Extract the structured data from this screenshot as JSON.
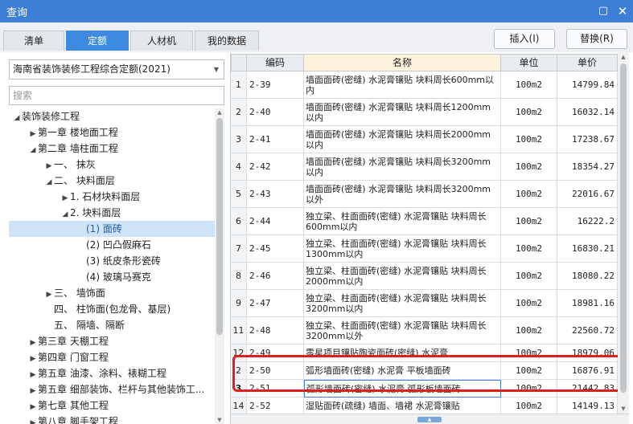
{
  "window": {
    "title": "查询"
  },
  "tabs": [
    {
      "label": "清单",
      "active": false
    },
    {
      "label": "定额",
      "active": true
    },
    {
      "label": "人材机",
      "active": false
    },
    {
      "label": "我的数据",
      "active": false
    }
  ],
  "actions": {
    "insert_label": "插入(I)",
    "replace_label": "替换(R)"
  },
  "left": {
    "library_select": "海南省装饰装修工程综合定额(2021)",
    "search_placeholder": "搜索",
    "tree": [
      {
        "label": "装饰装修工程",
        "indent": 0,
        "arrow": "down",
        "selected": false
      },
      {
        "label": "第一章 楼地面工程",
        "indent": 1,
        "arrow": "right",
        "selected": false
      },
      {
        "label": "第二章 墙柱面工程",
        "indent": 1,
        "arrow": "down",
        "selected": false
      },
      {
        "label": "一、 抹灰",
        "indent": 2,
        "arrow": "right",
        "selected": false
      },
      {
        "label": "二、 块料面层",
        "indent": 2,
        "arrow": "down",
        "selected": false
      },
      {
        "label": "1. 石材块料面层",
        "indent": 3,
        "arrow": "right",
        "selected": false
      },
      {
        "label": "2. 块料面层",
        "indent": 3,
        "arrow": "down",
        "selected": false
      },
      {
        "label": "(1) 面砖",
        "indent": 4,
        "arrow": "",
        "selected": true
      },
      {
        "label": "(2) 凹凸假麻石",
        "indent": 4,
        "arrow": "",
        "selected": false
      },
      {
        "label": "(3) 纸皮条形瓷砖",
        "indent": 4,
        "arrow": "",
        "selected": false
      },
      {
        "label": "(4) 玻璃马赛克",
        "indent": 4,
        "arrow": "",
        "selected": false
      },
      {
        "label": "三、 墙饰面",
        "indent": 2,
        "arrow": "right",
        "selected": false
      },
      {
        "label": "四、 柱饰面(包龙骨、基层)",
        "indent": 2,
        "arrow": "",
        "selected": false
      },
      {
        "label": "五、 隔墙、隔断",
        "indent": 2,
        "arrow": "",
        "selected": false
      },
      {
        "label": "第三章 天棚工程",
        "indent": 1,
        "arrow": "right",
        "selected": false
      },
      {
        "label": "第四章 门窗工程",
        "indent": 1,
        "arrow": "right",
        "selected": false
      },
      {
        "label": "第五章 油漆、涂料、裱糊工程",
        "indent": 1,
        "arrow": "right",
        "selected": false
      },
      {
        "label": "第五章 细部装饰、栏杆与其他装饰工...",
        "indent": 1,
        "arrow": "right",
        "selected": false
      },
      {
        "label": "第七章 其他工程",
        "indent": 1,
        "arrow": "right",
        "selected": false
      },
      {
        "label": "第八章 脚手架工程",
        "indent": 1,
        "arrow": "right",
        "selected": false
      }
    ]
  },
  "table": {
    "headers": {
      "code": "编码",
      "name": "名称",
      "unit": "单位",
      "price": "单价"
    },
    "rows": [
      {
        "idx": "1",
        "code": "2-39",
        "name": "墙面面砖(密缝) 水泥膏镶贴 块料周长600mm以内",
        "unit": "100m2",
        "price": "14799.84",
        "current": false,
        "h": 34
      },
      {
        "idx": "2",
        "code": "2-40",
        "name": "墙面面砖(密缝) 水泥膏镶贴 块料周长1200mm以内",
        "unit": "100m2",
        "price": "16032.14",
        "current": false,
        "h": 34
      },
      {
        "idx": "3",
        "code": "2-41",
        "name": "墙面面砖(密缝) 水泥膏镶贴 块料周长2000mm以内",
        "unit": "100m2",
        "price": "17238.67",
        "current": false,
        "h": 34
      },
      {
        "idx": "4",
        "code": "2-42",
        "name": "墙面面砖(密缝) 水泥膏镶贴 块料周长3200mm以内",
        "unit": "100m2",
        "price": "18354.27",
        "current": false,
        "h": 34
      },
      {
        "idx": "5",
        "code": "2-43",
        "name": "墙面面砖(密缝) 水泥膏镶贴 块料周长3200mm以外",
        "unit": "100m2",
        "price": "22016.67",
        "current": false,
        "h": 34
      },
      {
        "idx": "6",
        "code": "2-44",
        "name": "独立梁、柱面面砖(密缝) 水泥膏镶贴 块料周长600mm以内",
        "unit": "100m2",
        "price": "16222.2",
        "current": false,
        "h": 34
      },
      {
        "idx": "7",
        "code": "2-45",
        "name": "独立梁、柱面面砖(密缝) 水泥膏镶贴 块料周长1300mm以内",
        "unit": "100m2",
        "price": "16830.21",
        "current": false,
        "h": 34
      },
      {
        "idx": "8",
        "code": "2-46",
        "name": "独立梁、柱面面砖(密缝) 水泥膏镶贴 块料周长2000mm以内",
        "unit": "100m2",
        "price": "18080.22",
        "current": false,
        "h": 34
      },
      {
        "idx": "9",
        "code": "2-47",
        "name": "独立梁、柱面面砖(密缝) 水泥膏镶贴 块料周长3200mm以内",
        "unit": "100m2",
        "price": "18981.16",
        "current": false,
        "h": 34
      },
      {
        "idx": "11",
        "code": "2-48",
        "name": "独立梁、柱面面砖(密缝) 水泥膏镶贴 块料周长3200mm以外",
        "unit": "100m2",
        "price": "22560.72",
        "current": false,
        "h": 34
      },
      {
        "idx": "12",
        "code": "2-49",
        "name": "零星项目镶贴陶瓷面砖(密缝) 水泥膏",
        "unit": "100m2",
        "price": "18979.06",
        "current": false,
        "h": 22
      },
      {
        "idx": "2",
        "code": "2-50",
        "name": "弧形墙面砖(密缝) 水泥膏 平板墙面砖",
        "unit": "100m2",
        "price": "16876.91",
        "current": false,
        "h": 22
      },
      {
        "idx": "3",
        "code": "2-51",
        "name": "弧形墙面砖(密缝) 水泥膏 弧形板墙面砖",
        "unit": "100m2",
        "price": "21442.83",
        "current": true,
        "h": 22
      },
      {
        "idx": "14",
        "code": "2-52",
        "name": "湿贴面砖(疏缝) 墙面、墙裙 水泥膏镶贴",
        "unit": "100m2",
        "price": "14149.13",
        "current": false,
        "h": 22
      }
    ]
  },
  "colors": {
    "titlebar": "#3d7fd6",
    "tab_active": "#3d8ae0",
    "highlight": "#e01e1e",
    "tree_selected": "#cfe3f7"
  }
}
